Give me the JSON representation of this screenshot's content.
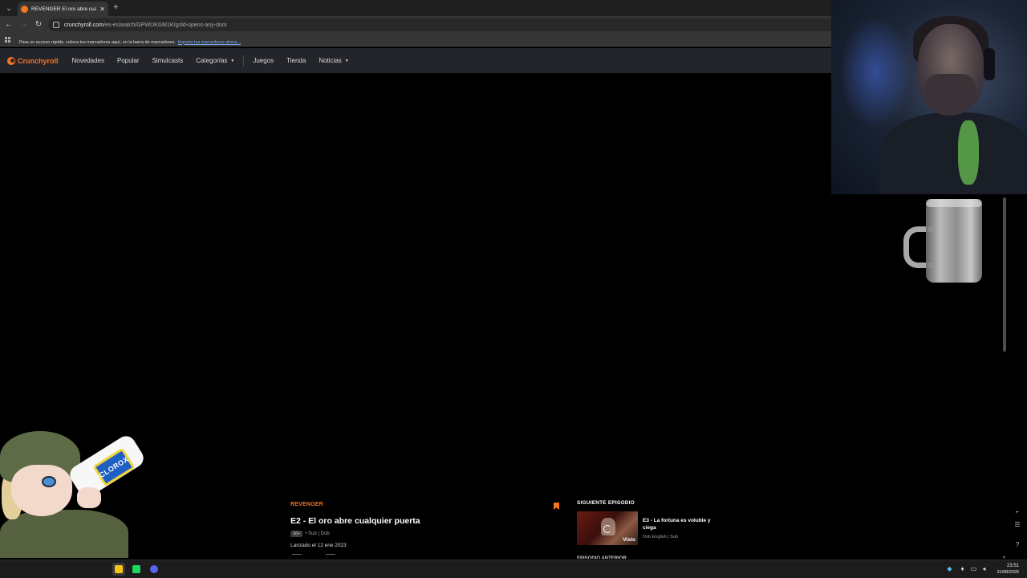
{
  "browser": {
    "tab_title": "REVENGER El oro abre cualquier puerta",
    "tab_close": "✕",
    "new_tab": "+",
    "url_host": "crunchyroll.com",
    "url_path": "/es-es/watch/GPWUKGM1K/gold-opens-any-door",
    "bookmarks_message": "Para un acceso rápido, coloca tus marcadores aquí, en la barra de marcadores.",
    "bookmarks_import_link": "Importa tus marcadores ahora..."
  },
  "site": {
    "logo_text": "Crunchyroll",
    "accent_color": "#f47521",
    "nav": [
      {
        "label": "Novedades"
      },
      {
        "label": "Popular"
      },
      {
        "label": "Simulcasts"
      },
      {
        "label": "Categorías"
      },
      {
        "label": "Juegos"
      },
      {
        "label": "Tienda"
      },
      {
        "label": "Noticias"
      }
    ]
  },
  "episode": {
    "series": "REVENGER",
    "title": "E2 - El oro abre cualquier puerta",
    "rating": "16+",
    "audio": "• Sub | Dob",
    "release": "Lanzado el 12 ene 2023"
  },
  "next_episode": {
    "heading": "SIGUIENTE EPISODIO",
    "title": "E3 - La fortuna es voluble y ciega",
    "meta": "Dob English | Sub",
    "watched_label": "Visto"
  },
  "previous_episode": {
    "heading": "EPISODIO ANTERIOR"
  },
  "overlays": {
    "mascot_bottle_text": "CLOROX"
  },
  "taskbar": {
    "time": "23:51",
    "date": "31/08/2026",
    "apps": [
      {
        "icon": "sticky-notes-icon",
        "color": "#f5c518"
      },
      {
        "icon": "spotify-like-icon",
        "color": "#1ed760"
      },
      {
        "icon": "discord-icon",
        "color": "#5865f2"
      }
    ]
  }
}
